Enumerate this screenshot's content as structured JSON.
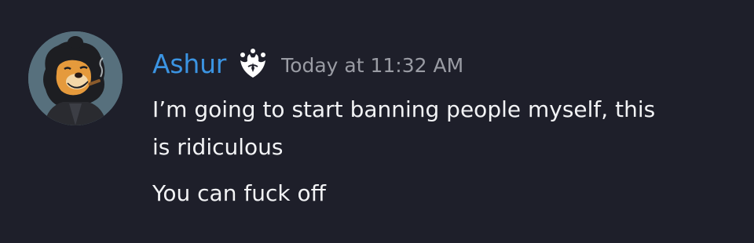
{
  "message": {
    "author": {
      "username": "Ashur",
      "username_color": "#3b94e2",
      "avatar_icon": "lion-avatar",
      "badge_icon": "paw-shield-badge-icon"
    },
    "timestamp": "Today at 11:32 AM",
    "lines": [
      "I’m going to start banning people myself, this",
      "is ridiculous",
      "You can fuck off"
    ]
  },
  "colors": {
    "background": "#1e1f2a",
    "text": "#f2f3f5",
    "timestamp": "#9a9ca4"
  }
}
